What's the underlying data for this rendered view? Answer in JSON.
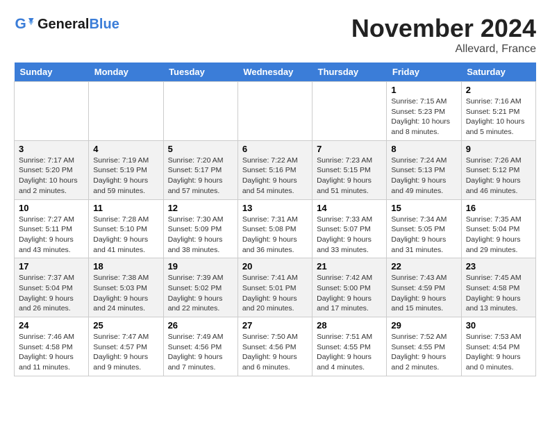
{
  "header": {
    "logo_text_general": "General",
    "logo_text_blue": "Blue",
    "month_title": "November 2024",
    "location": "Allevard, France"
  },
  "days_of_week": [
    "Sunday",
    "Monday",
    "Tuesday",
    "Wednesday",
    "Thursday",
    "Friday",
    "Saturday"
  ],
  "weeks": [
    [
      {
        "num": "",
        "info": ""
      },
      {
        "num": "",
        "info": ""
      },
      {
        "num": "",
        "info": ""
      },
      {
        "num": "",
        "info": ""
      },
      {
        "num": "",
        "info": ""
      },
      {
        "num": "1",
        "info": "Sunrise: 7:15 AM\nSunset: 5:23 PM\nDaylight: 10 hours and 8 minutes."
      },
      {
        "num": "2",
        "info": "Sunrise: 7:16 AM\nSunset: 5:21 PM\nDaylight: 10 hours and 5 minutes."
      }
    ],
    [
      {
        "num": "3",
        "info": "Sunrise: 7:17 AM\nSunset: 5:20 PM\nDaylight: 10 hours and 2 minutes."
      },
      {
        "num": "4",
        "info": "Sunrise: 7:19 AM\nSunset: 5:19 PM\nDaylight: 9 hours and 59 minutes."
      },
      {
        "num": "5",
        "info": "Sunrise: 7:20 AM\nSunset: 5:17 PM\nDaylight: 9 hours and 57 minutes."
      },
      {
        "num": "6",
        "info": "Sunrise: 7:22 AM\nSunset: 5:16 PM\nDaylight: 9 hours and 54 minutes."
      },
      {
        "num": "7",
        "info": "Sunrise: 7:23 AM\nSunset: 5:15 PM\nDaylight: 9 hours and 51 minutes."
      },
      {
        "num": "8",
        "info": "Sunrise: 7:24 AM\nSunset: 5:13 PM\nDaylight: 9 hours and 49 minutes."
      },
      {
        "num": "9",
        "info": "Sunrise: 7:26 AM\nSunset: 5:12 PM\nDaylight: 9 hours and 46 minutes."
      }
    ],
    [
      {
        "num": "10",
        "info": "Sunrise: 7:27 AM\nSunset: 5:11 PM\nDaylight: 9 hours and 43 minutes."
      },
      {
        "num": "11",
        "info": "Sunrise: 7:28 AM\nSunset: 5:10 PM\nDaylight: 9 hours and 41 minutes."
      },
      {
        "num": "12",
        "info": "Sunrise: 7:30 AM\nSunset: 5:09 PM\nDaylight: 9 hours and 38 minutes."
      },
      {
        "num": "13",
        "info": "Sunrise: 7:31 AM\nSunset: 5:08 PM\nDaylight: 9 hours and 36 minutes."
      },
      {
        "num": "14",
        "info": "Sunrise: 7:33 AM\nSunset: 5:07 PM\nDaylight: 9 hours and 33 minutes."
      },
      {
        "num": "15",
        "info": "Sunrise: 7:34 AM\nSunset: 5:05 PM\nDaylight: 9 hours and 31 minutes."
      },
      {
        "num": "16",
        "info": "Sunrise: 7:35 AM\nSunset: 5:04 PM\nDaylight: 9 hours and 29 minutes."
      }
    ],
    [
      {
        "num": "17",
        "info": "Sunrise: 7:37 AM\nSunset: 5:04 PM\nDaylight: 9 hours and 26 minutes."
      },
      {
        "num": "18",
        "info": "Sunrise: 7:38 AM\nSunset: 5:03 PM\nDaylight: 9 hours and 24 minutes."
      },
      {
        "num": "19",
        "info": "Sunrise: 7:39 AM\nSunset: 5:02 PM\nDaylight: 9 hours and 22 minutes."
      },
      {
        "num": "20",
        "info": "Sunrise: 7:41 AM\nSunset: 5:01 PM\nDaylight: 9 hours and 20 minutes."
      },
      {
        "num": "21",
        "info": "Sunrise: 7:42 AM\nSunset: 5:00 PM\nDaylight: 9 hours and 17 minutes."
      },
      {
        "num": "22",
        "info": "Sunrise: 7:43 AM\nSunset: 4:59 PM\nDaylight: 9 hours and 15 minutes."
      },
      {
        "num": "23",
        "info": "Sunrise: 7:45 AM\nSunset: 4:58 PM\nDaylight: 9 hours and 13 minutes."
      }
    ],
    [
      {
        "num": "24",
        "info": "Sunrise: 7:46 AM\nSunset: 4:58 PM\nDaylight: 9 hours and 11 minutes."
      },
      {
        "num": "25",
        "info": "Sunrise: 7:47 AM\nSunset: 4:57 PM\nDaylight: 9 hours and 9 minutes."
      },
      {
        "num": "26",
        "info": "Sunrise: 7:49 AM\nSunset: 4:56 PM\nDaylight: 9 hours and 7 minutes."
      },
      {
        "num": "27",
        "info": "Sunrise: 7:50 AM\nSunset: 4:56 PM\nDaylight: 9 hours and 6 minutes."
      },
      {
        "num": "28",
        "info": "Sunrise: 7:51 AM\nSunset: 4:55 PM\nDaylight: 9 hours and 4 minutes."
      },
      {
        "num": "29",
        "info": "Sunrise: 7:52 AM\nSunset: 4:55 PM\nDaylight: 9 hours and 2 minutes."
      },
      {
        "num": "30",
        "info": "Sunrise: 7:53 AM\nSunset: 4:54 PM\nDaylight: 9 hours and 0 minutes."
      }
    ]
  ]
}
